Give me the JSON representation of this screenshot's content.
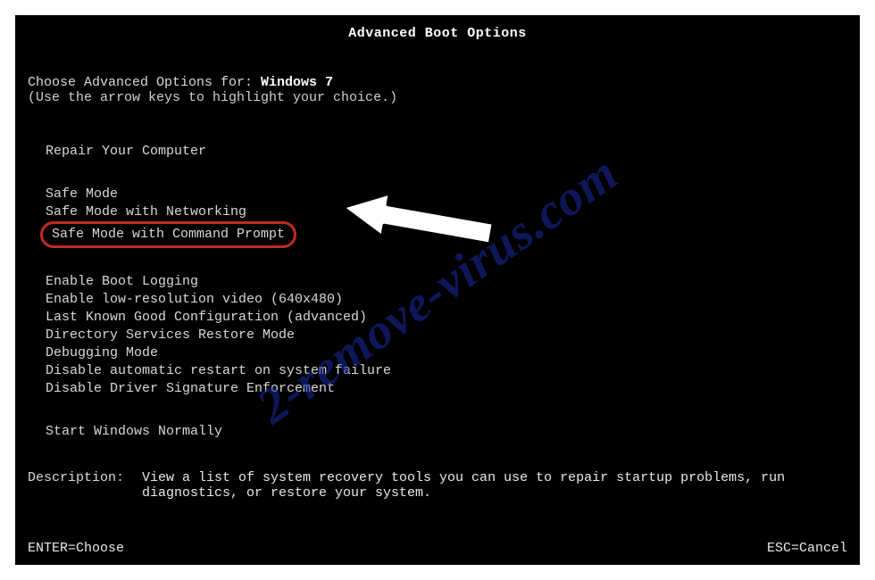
{
  "title": "Advanced Boot Options",
  "choose": {
    "prefix": "Choose Advanced Options for: ",
    "os": "Windows 7",
    "hint": "(Use the arrow keys to highlight your choice.)"
  },
  "groups": {
    "repair": [
      "Repair Your Computer"
    ],
    "safe": [
      "Safe Mode",
      "Safe Mode with Networking",
      "Safe Mode with Command Prompt"
    ],
    "advanced": [
      "Enable Boot Logging",
      "Enable low-resolution video (640x480)",
      "Last Known Good Configuration (advanced)",
      "Directory Services Restore Mode",
      "Debugging Mode",
      "Disable automatic restart on system failure",
      "Disable Driver Signature Enforcement"
    ],
    "normal": [
      "Start Windows Normally"
    ]
  },
  "description": {
    "label": "Description:",
    "text": "View a list of system recovery tools you can use to repair startup problems, run diagnostics, or restore your system."
  },
  "footer": {
    "enter": "ENTER=Choose",
    "esc": "ESC=Cancel"
  },
  "watermark": "2-remove-virus.com",
  "colors": {
    "highlight_border": "#c22b1f",
    "watermark": "#1a2a9e"
  }
}
